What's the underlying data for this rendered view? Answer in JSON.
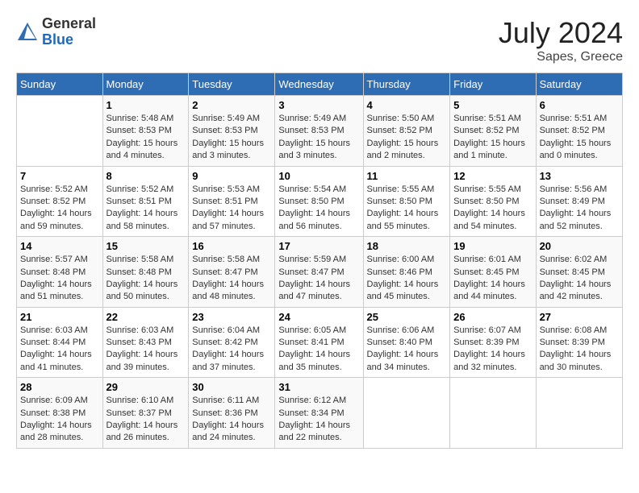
{
  "header": {
    "logo_general": "General",
    "logo_blue": "Blue",
    "month_year": "July 2024",
    "location": "Sapes, Greece"
  },
  "days_of_week": [
    "Sunday",
    "Monday",
    "Tuesday",
    "Wednesday",
    "Thursday",
    "Friday",
    "Saturday"
  ],
  "weeks": [
    [
      {
        "day": "",
        "sunrise": "",
        "sunset": "",
        "daylight": ""
      },
      {
        "day": "1",
        "sunrise": "Sunrise: 5:48 AM",
        "sunset": "Sunset: 8:53 PM",
        "daylight": "Daylight: 15 hours and 4 minutes."
      },
      {
        "day": "2",
        "sunrise": "Sunrise: 5:49 AM",
        "sunset": "Sunset: 8:53 PM",
        "daylight": "Daylight: 15 hours and 3 minutes."
      },
      {
        "day": "3",
        "sunrise": "Sunrise: 5:49 AM",
        "sunset": "Sunset: 8:53 PM",
        "daylight": "Daylight: 15 hours and 3 minutes."
      },
      {
        "day": "4",
        "sunrise": "Sunrise: 5:50 AM",
        "sunset": "Sunset: 8:52 PM",
        "daylight": "Daylight: 15 hours and 2 minutes."
      },
      {
        "day": "5",
        "sunrise": "Sunrise: 5:51 AM",
        "sunset": "Sunset: 8:52 PM",
        "daylight": "Daylight: 15 hours and 1 minute."
      },
      {
        "day": "6",
        "sunrise": "Sunrise: 5:51 AM",
        "sunset": "Sunset: 8:52 PM",
        "daylight": "Daylight: 15 hours and 0 minutes."
      }
    ],
    [
      {
        "day": "7",
        "sunrise": "Sunrise: 5:52 AM",
        "sunset": "Sunset: 8:52 PM",
        "daylight": "Daylight: 14 hours and 59 minutes."
      },
      {
        "day": "8",
        "sunrise": "Sunrise: 5:52 AM",
        "sunset": "Sunset: 8:51 PM",
        "daylight": "Daylight: 14 hours and 58 minutes."
      },
      {
        "day": "9",
        "sunrise": "Sunrise: 5:53 AM",
        "sunset": "Sunset: 8:51 PM",
        "daylight": "Daylight: 14 hours and 57 minutes."
      },
      {
        "day": "10",
        "sunrise": "Sunrise: 5:54 AM",
        "sunset": "Sunset: 8:50 PM",
        "daylight": "Daylight: 14 hours and 56 minutes."
      },
      {
        "day": "11",
        "sunrise": "Sunrise: 5:55 AM",
        "sunset": "Sunset: 8:50 PM",
        "daylight": "Daylight: 14 hours and 55 minutes."
      },
      {
        "day": "12",
        "sunrise": "Sunrise: 5:55 AM",
        "sunset": "Sunset: 8:50 PM",
        "daylight": "Daylight: 14 hours and 54 minutes."
      },
      {
        "day": "13",
        "sunrise": "Sunrise: 5:56 AM",
        "sunset": "Sunset: 8:49 PM",
        "daylight": "Daylight: 14 hours and 52 minutes."
      }
    ],
    [
      {
        "day": "14",
        "sunrise": "Sunrise: 5:57 AM",
        "sunset": "Sunset: 8:48 PM",
        "daylight": "Daylight: 14 hours and 51 minutes."
      },
      {
        "day": "15",
        "sunrise": "Sunrise: 5:58 AM",
        "sunset": "Sunset: 8:48 PM",
        "daylight": "Daylight: 14 hours and 50 minutes."
      },
      {
        "day": "16",
        "sunrise": "Sunrise: 5:58 AM",
        "sunset": "Sunset: 8:47 PM",
        "daylight": "Daylight: 14 hours and 48 minutes."
      },
      {
        "day": "17",
        "sunrise": "Sunrise: 5:59 AM",
        "sunset": "Sunset: 8:47 PM",
        "daylight": "Daylight: 14 hours and 47 minutes."
      },
      {
        "day": "18",
        "sunrise": "Sunrise: 6:00 AM",
        "sunset": "Sunset: 8:46 PM",
        "daylight": "Daylight: 14 hours and 45 minutes."
      },
      {
        "day": "19",
        "sunrise": "Sunrise: 6:01 AM",
        "sunset": "Sunset: 8:45 PM",
        "daylight": "Daylight: 14 hours and 44 minutes."
      },
      {
        "day": "20",
        "sunrise": "Sunrise: 6:02 AM",
        "sunset": "Sunset: 8:45 PM",
        "daylight": "Daylight: 14 hours and 42 minutes."
      }
    ],
    [
      {
        "day": "21",
        "sunrise": "Sunrise: 6:03 AM",
        "sunset": "Sunset: 8:44 PM",
        "daylight": "Daylight: 14 hours and 41 minutes."
      },
      {
        "day": "22",
        "sunrise": "Sunrise: 6:03 AM",
        "sunset": "Sunset: 8:43 PM",
        "daylight": "Daylight: 14 hours and 39 minutes."
      },
      {
        "day": "23",
        "sunrise": "Sunrise: 6:04 AM",
        "sunset": "Sunset: 8:42 PM",
        "daylight": "Daylight: 14 hours and 37 minutes."
      },
      {
        "day": "24",
        "sunrise": "Sunrise: 6:05 AM",
        "sunset": "Sunset: 8:41 PM",
        "daylight": "Daylight: 14 hours and 35 minutes."
      },
      {
        "day": "25",
        "sunrise": "Sunrise: 6:06 AM",
        "sunset": "Sunset: 8:40 PM",
        "daylight": "Daylight: 14 hours and 34 minutes."
      },
      {
        "day": "26",
        "sunrise": "Sunrise: 6:07 AM",
        "sunset": "Sunset: 8:39 PM",
        "daylight": "Daylight: 14 hours and 32 minutes."
      },
      {
        "day": "27",
        "sunrise": "Sunrise: 6:08 AM",
        "sunset": "Sunset: 8:39 PM",
        "daylight": "Daylight: 14 hours and 30 minutes."
      }
    ],
    [
      {
        "day": "28",
        "sunrise": "Sunrise: 6:09 AM",
        "sunset": "Sunset: 8:38 PM",
        "daylight": "Daylight: 14 hours and 28 minutes."
      },
      {
        "day": "29",
        "sunrise": "Sunrise: 6:10 AM",
        "sunset": "Sunset: 8:37 PM",
        "daylight": "Daylight: 14 hours and 26 minutes."
      },
      {
        "day": "30",
        "sunrise": "Sunrise: 6:11 AM",
        "sunset": "Sunset: 8:36 PM",
        "daylight": "Daylight: 14 hours and 24 minutes."
      },
      {
        "day": "31",
        "sunrise": "Sunrise: 6:12 AM",
        "sunset": "Sunset: 8:34 PM",
        "daylight": "Daylight: 14 hours and 22 minutes."
      },
      {
        "day": "",
        "sunrise": "",
        "sunset": "",
        "daylight": ""
      },
      {
        "day": "",
        "sunrise": "",
        "sunset": "",
        "daylight": ""
      },
      {
        "day": "",
        "sunrise": "",
        "sunset": "",
        "daylight": ""
      }
    ]
  ]
}
